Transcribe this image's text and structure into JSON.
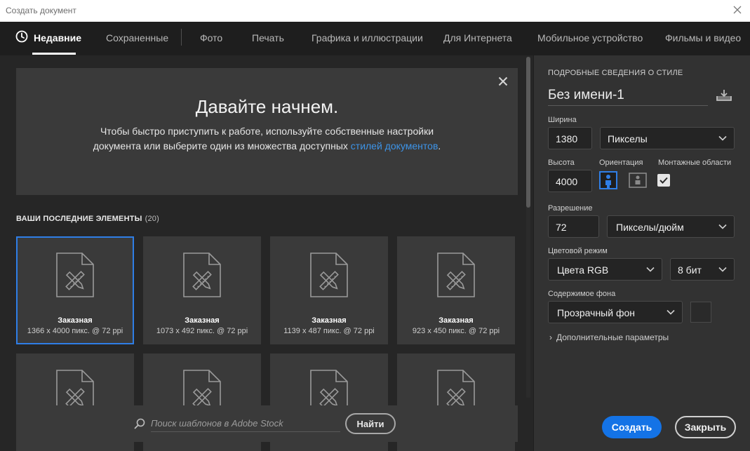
{
  "window": {
    "title": "Создать документ"
  },
  "tabs": [
    {
      "label": "Недавние",
      "active": true
    },
    {
      "label": "Сохраненные"
    },
    {
      "label": "Фото"
    },
    {
      "label": "Печать"
    },
    {
      "label": "Графика и иллюстрации"
    },
    {
      "label": "Для Интернета"
    },
    {
      "label": "Мобильное устройство"
    },
    {
      "label": "Фильмы и видео"
    }
  ],
  "welcome": {
    "title": "Давайте начнем.",
    "text": "Чтобы быстро приступить к работе, используйте собственные настройки документа или выберите один из множества доступных ",
    "link_text": "стилей документов",
    "text_end": "."
  },
  "recent": {
    "heading": "ВАШИ ПОСЛЕДНИЕ ЭЛЕМЕНТЫ",
    "count": "(20)",
    "items": [
      {
        "name": "Заказная",
        "dims": "1366 x 4000 пикс. @ 72 ppi",
        "selected": true
      },
      {
        "name": "Заказная",
        "dims": "1073 x 492 пикс. @ 72 ppi"
      },
      {
        "name": "Заказная",
        "dims": "1139 x 487 пикс. @ 72 ppi"
      },
      {
        "name": "Заказная",
        "dims": "923 x 450 пикс. @ 72 ppi"
      }
    ]
  },
  "search": {
    "placeholder": "Поиск шаблонов в Adobe Stock",
    "button_label": "Найти"
  },
  "panel": {
    "heading": "ПОДРОБНЫЕ СВЕДЕНИЯ О СТИЛЕ",
    "doc_name": "Без имени-1",
    "width_label": "Ширина",
    "width_value": "1380",
    "width_unit": "Пикселы",
    "height_label": "Высота",
    "height_value": "4000",
    "orientation_label": "Ориентация",
    "artboards_label": "Монтажные области",
    "artboards_checked": true,
    "resolution_label": "Разрешение",
    "resolution_value": "72",
    "resolution_unit": "Пикселы/дюйм",
    "color_mode_label": "Цветовой режим",
    "color_mode_value": "Цвета RGB",
    "bit_depth_value": "8 бит",
    "background_label": "Содержимое фона",
    "background_value": "Прозрачный фон",
    "more_params": "Дополнительные параметры",
    "create_label": "Создать",
    "close_label": "Закрыть"
  },
  "colors": {
    "accent": "#1473e6",
    "link": "#3d94e8",
    "selected_border": "#2f7ee6"
  }
}
